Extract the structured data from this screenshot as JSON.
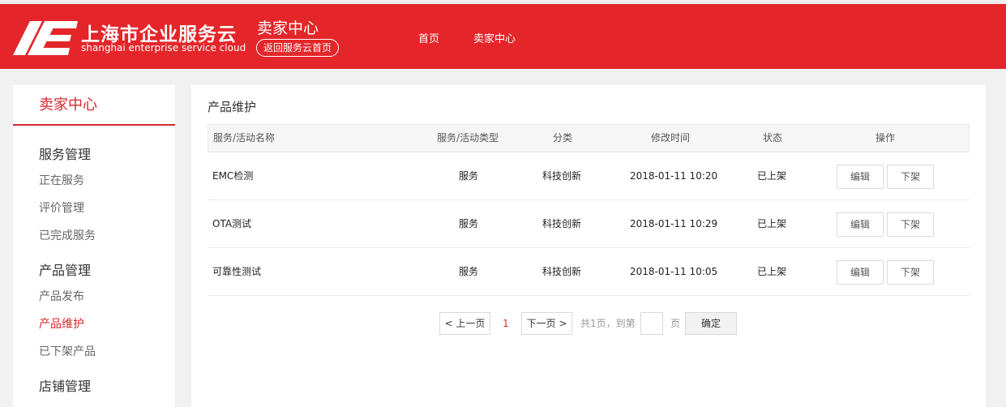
{
  "header": {
    "brand_cn": "上海市企业服务云",
    "brand_en": "shanghai enterprise service cloud",
    "section_title": "卖家中心",
    "back_link": "返回服务云首页",
    "nav": [
      "首页",
      "卖家中心"
    ],
    "color": "#e4262a"
  },
  "sidebar": {
    "title": "卖家中心",
    "groups": [
      {
        "title": "服务管理",
        "items": [
          "正在服务",
          "评价管理",
          "已完成服务"
        ]
      },
      {
        "title": "产品管理",
        "items": [
          "产品发布",
          "产品维护",
          "已下架产品"
        ]
      },
      {
        "title": "店铺管理",
        "items": []
      }
    ],
    "active_item": "产品维护",
    "accent_color": "#d7282e"
  },
  "main": {
    "title": "产品维护",
    "columns": [
      "服务/活动名称",
      "服务/活动类型",
      "分类",
      "修改时间",
      "状态",
      "操作"
    ],
    "rows": [
      {
        "name": "EMC检测",
        "type": "服务",
        "category": "科技创新",
        "time": "2018-01-11 10:20",
        "status": "已上架",
        "edit": "编辑",
        "offshelf": "下架"
      },
      {
        "name": "OTA测试",
        "type": "服务",
        "category": "科技创新",
        "time": "2018-01-11 10:29",
        "status": "已上架",
        "edit": "编辑",
        "offshelf": "下架"
      },
      {
        "name": "可靠性测试",
        "type": "服务",
        "category": "科技创新",
        "time": "2018-01-11 10:05",
        "status": "已上架",
        "edit": "编辑",
        "offshelf": "下架"
      }
    ]
  },
  "pager": {
    "prev": "< 上一页",
    "current": "1",
    "next": "下一页 >",
    "total_text": "共1页，到第",
    "page_unit": "页",
    "input_value": "",
    "confirm": "确定"
  }
}
